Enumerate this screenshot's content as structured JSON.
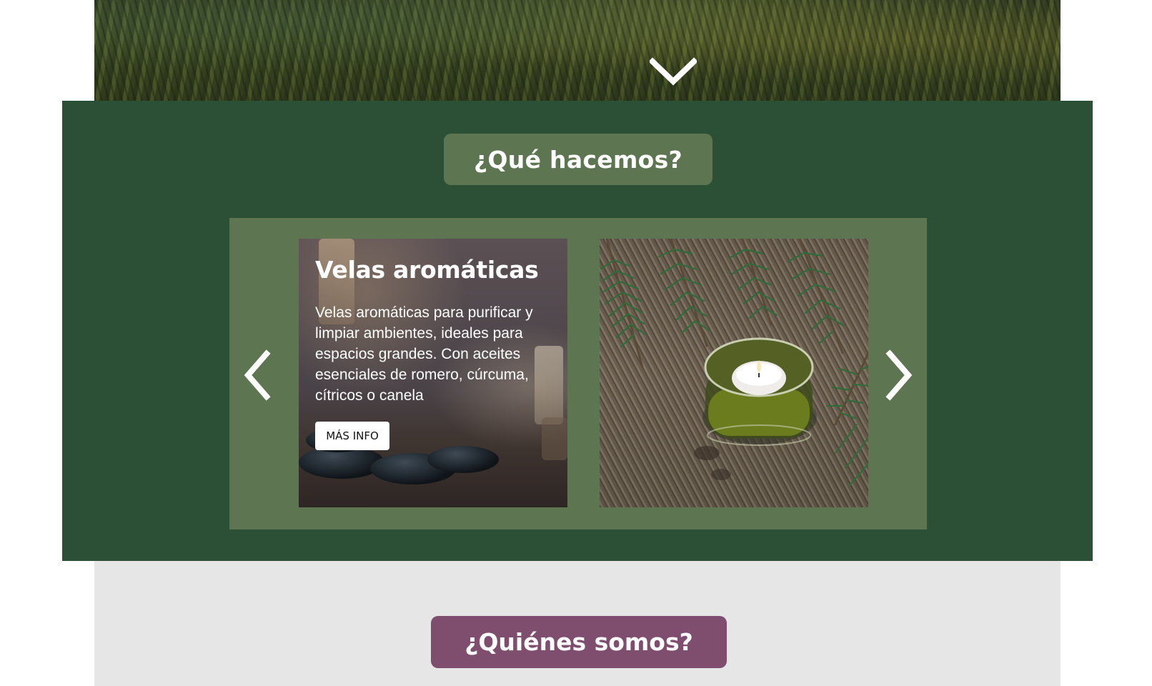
{
  "hero": {
    "scroll_icon": "chevron-down-icon"
  },
  "what_section": {
    "title": "¿Qué hacemos?",
    "background_color": "#2c5035",
    "carousel": {
      "prev_icon": "chevron-left-icon",
      "next_icon": "chevron-right-icon",
      "cards": [
        {
          "title": "Velas aromáticas",
          "description": "Velas aromáticas para purificar y limpiar ambientes, ideales para espacios grandes. Con aceites esenciales de romero, cúrcuma, cítricos o canela",
          "button_label": "MÁS INFO"
        },
        {
          "image": "candle-with-pine-branches-photo"
        }
      ]
    }
  },
  "who_section": {
    "title": "¿Quiénes somos?",
    "accent_color": "#7f4e6f"
  }
}
